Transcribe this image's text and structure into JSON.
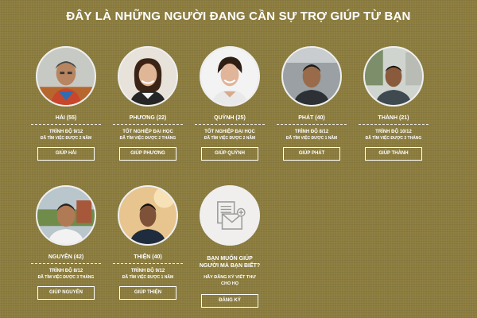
{
  "page": {
    "title": "ĐÂY LÀ NHỮNG NGƯỜI ĐANG CẦN SỰ TRỢ GIÚP TỪ BẠN"
  },
  "people": [
    {
      "name": "HẢI (55)",
      "line1": "TRÌNH ĐỘ 9/12",
      "line2": "ĐÃ TÌM VIỆC ĐƯỢC 2 NĂM",
      "button": "GIÚP HẢI"
    },
    {
      "name": "PHƯƠNG (22)",
      "line1": "TỐT NGHIỆP ĐẠI HỌC",
      "line2": "ĐÃ TÌM VIỆC ĐƯỢC 2 THÁNG",
      "button": "GIÚP PHƯƠNG"
    },
    {
      "name": "QUỲNH (25)",
      "line1": "TỐT NGHIỆP ĐẠI HỌC",
      "line2": "ĐÃ TÌM VIỆC ĐƯỢC 2 NĂM",
      "button": "GIÚP QUỲNH"
    },
    {
      "name": "PHÁT (40)",
      "line1": "TRÌNH ĐỘ 8/12",
      "line2": "ĐÃ TÌM VIỆC ĐƯỢC 1 NĂM",
      "button": "GIÚP PHÁT"
    },
    {
      "name": "THÀNH (21)",
      "line1": "TRÌNH ĐỘ 10/12",
      "line2": "ĐÃ TÌM VIỆC ĐƯỢC 3 THÁNG",
      "button": "GIÚP THÀNH"
    },
    {
      "name": "NGUYÊN (42)",
      "line1": "TRÌNH ĐỘ 8/12",
      "line2": "ĐÃ TÌM VIỆC ĐƯỢC 3 THÁNG",
      "button": "GIÚP NGUYÊN"
    },
    {
      "name": "THIỆN (40)",
      "line1": "TRÌNH ĐỘ 9/12",
      "line2": "ĐÃ TÌM VIỆC ĐƯỢC 1 NĂM",
      "button": "GIÚP THIỆN"
    }
  ],
  "invite": {
    "icon": "letter-icon",
    "question_line1": "BẠN MUỐN GIÚP",
    "question_line2": "NGƯỜI MÀ BẠN BIẾT?",
    "sub_line1": "HÃY ĐĂNG KÝ VIẾT THƯ",
    "sub_line2": "CHO HỌ",
    "button": "ĐĂNG KÝ"
  },
  "colors": {
    "background": "#8c7d3f",
    "text": "#ffffff",
    "circle": "#f0efed",
    "icon": "#9a9a9a"
  }
}
